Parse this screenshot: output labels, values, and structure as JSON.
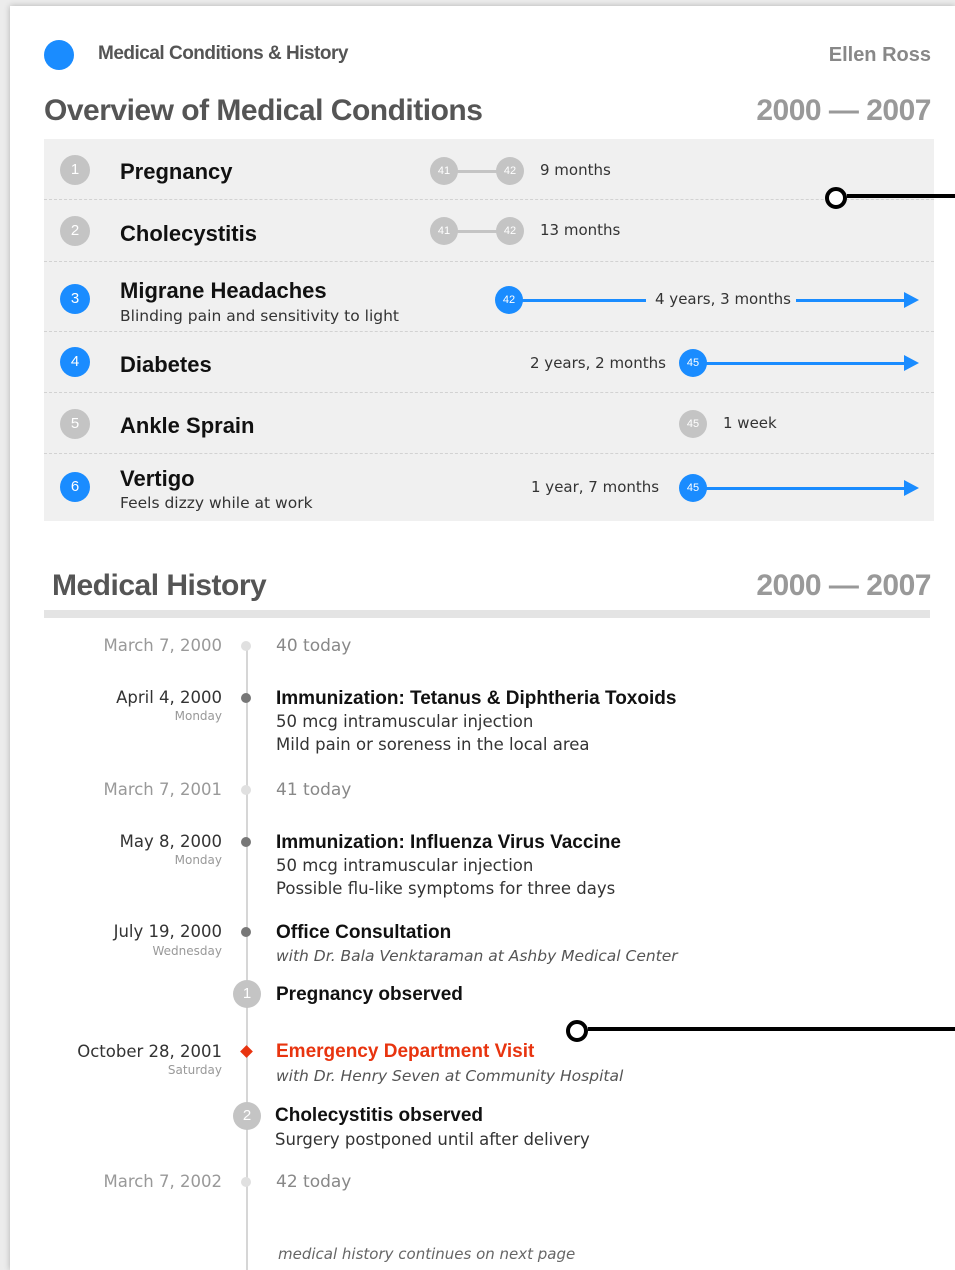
{
  "header": {
    "app_title": "Medical Conditions & History",
    "patient_name": "Ellen Ross",
    "accent_color": "#1a8cff"
  },
  "overview": {
    "title": "Overview of Medical Conditions",
    "range": "2000 — 2007",
    "conditions": [
      {
        "num": "1",
        "name": "Pregnancy",
        "subtitle": "",
        "start_age": "41",
        "end_age": "42",
        "duration": "9 months",
        "ongoing": false
      },
      {
        "num": "2",
        "name": "Cholecystitis",
        "subtitle": "",
        "start_age": "41",
        "end_age": "42",
        "duration": "13 months",
        "ongoing": false
      },
      {
        "num": "3",
        "name": "Migrane Headaches",
        "subtitle": "Blinding pain and sensitivity to light",
        "start_age": "42",
        "duration": "4 years, 3 months",
        "ongoing": true
      },
      {
        "num": "4",
        "name": "Diabetes",
        "subtitle": "",
        "start_age": "45",
        "duration": "2 years, 2 months",
        "ongoing": true
      },
      {
        "num": "5",
        "name": "Ankle Sprain",
        "subtitle": "",
        "start_age": "45",
        "duration": "1 week",
        "ongoing": false
      },
      {
        "num": "6",
        "name": "Vertigo",
        "subtitle": "Feels dizzy while at work",
        "start_age": "45",
        "duration": "1 year, 7 months",
        "ongoing": true
      }
    ]
  },
  "history": {
    "title": "Medical History",
    "range": "2000 — 2007",
    "events": [
      {
        "date": "March 7, 2000",
        "weekday": "",
        "kind": "birthday",
        "title": "40 today"
      },
      {
        "date": "April 4, 2000",
        "weekday": "Monday",
        "kind": "event",
        "title": "Immunization: Tetanus & Diphtheria Toxoids",
        "lines": [
          "50 mcg intramuscular injection",
          "Mild pain or soreness in the local area"
        ]
      },
      {
        "date": "March 7, 2001",
        "weekday": "",
        "kind": "birthday",
        "title": "41 today"
      },
      {
        "date": "May 8, 2000",
        "weekday": "Monday",
        "kind": "event",
        "title": "Immunization: Influenza Virus Vaccine",
        "lines": [
          "50 mcg intramuscular injection",
          "Possible flu-like symptoms for three days"
        ]
      },
      {
        "date": "July 19, 2000",
        "weekday": "Wednesday",
        "kind": "event",
        "title": "Office Consultation",
        "lines": [
          "with Dr. Bala Venktaraman at Ashby Medical Center"
        ]
      },
      {
        "date": "",
        "weekday": "",
        "kind": "condition",
        "badge": "1",
        "title": "Pregnancy observed"
      },
      {
        "date": "October 28, 2001",
        "weekday": "Saturday",
        "kind": "emergency",
        "title": "Emergency Department Visit",
        "lines": [
          "with Dr. Henry Seven at Community Hospital"
        ]
      },
      {
        "date": "",
        "weekday": "",
        "kind": "condition",
        "badge": "2",
        "title": "Cholecystitis observed",
        "lines": [
          "Surgery postponed until after delivery"
        ]
      },
      {
        "date": "March 7, 2002",
        "weekday": "",
        "kind": "birthday",
        "title": "42 today"
      }
    ],
    "continues_note": "medical history continues on next page",
    "emergency_color": "#e8340f"
  }
}
